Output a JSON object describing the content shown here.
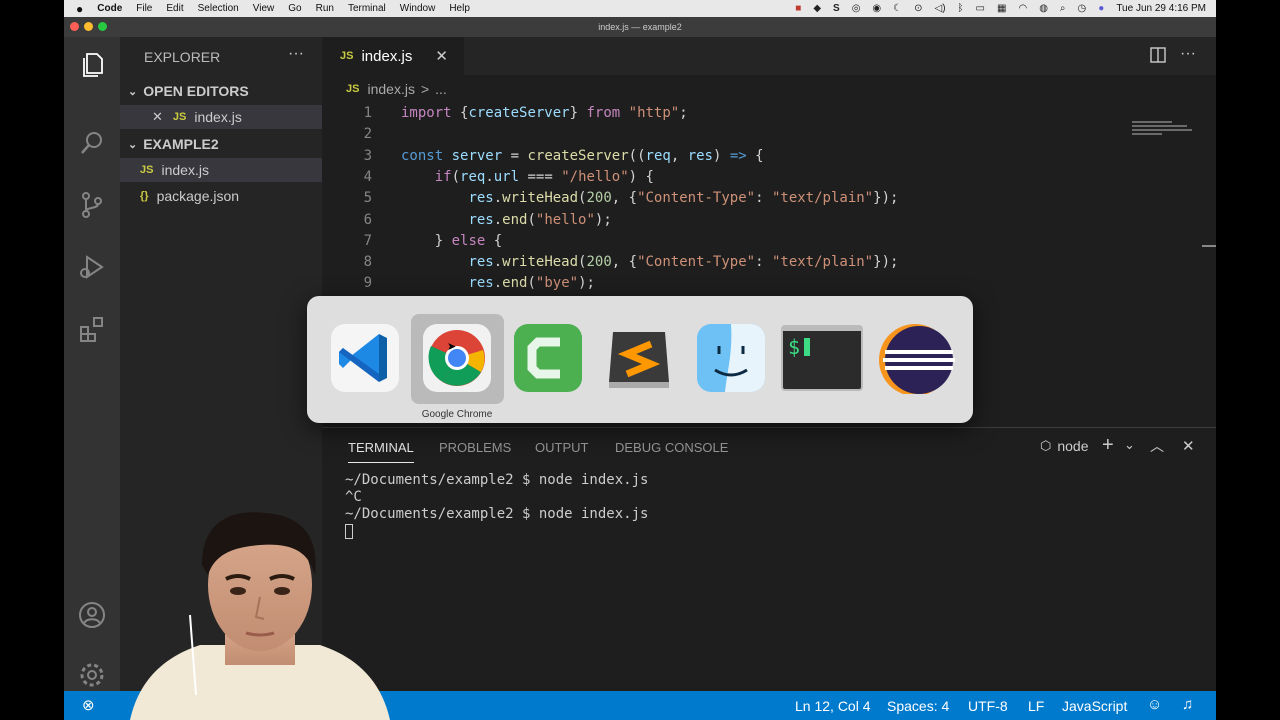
{
  "menubar": {
    "app_name": "Code",
    "items": [
      "File",
      "Edit",
      "Selection",
      "View",
      "Go",
      "Run",
      "Terminal",
      "Window",
      "Help"
    ],
    "clock": "Tue Jun 29  4:16 PM"
  },
  "window": {
    "title": "index.js — example2"
  },
  "explorer": {
    "title": "EXPLORER",
    "open_editors_label": "OPEN EDITORS",
    "open_editors": [
      {
        "badge": "JS",
        "name": "index.js"
      }
    ],
    "folder_label": "EXAMPLE2",
    "files": [
      {
        "badge": "JS",
        "name": "index.js"
      },
      {
        "badge": "{}",
        "name": "package.json"
      }
    ]
  },
  "editor": {
    "tab": {
      "badge": "JS",
      "name": "index.js"
    },
    "breadcrumb": {
      "badge": "JS",
      "file": "index.js",
      "sep": ">",
      "more": "..."
    },
    "lines": [
      {
        "n": "1",
        "text": "import {createServer} from \"http\";"
      },
      {
        "n": "2",
        "text": ""
      },
      {
        "n": "3",
        "text": "const server = createServer((req, res) => {"
      },
      {
        "n": "4",
        "text": "    if(req.url === \"/hello\") {"
      },
      {
        "n": "5",
        "text": "        res.writeHead(200, {\"Content-Type\": \"text/plain\"});"
      },
      {
        "n": "6",
        "text": "        res.end(\"hello\");"
      },
      {
        "n": "7",
        "text": "    } else {"
      },
      {
        "n": "8",
        "text": "        res.writeHead(200, {\"Content-Type\": \"text/plain\"});"
      },
      {
        "n": "9",
        "text": "        res.end(\"bye\");"
      }
    ]
  },
  "panel": {
    "tabs": [
      "TERMINAL",
      "PROBLEMS",
      "OUTPUT",
      "DEBUG CONSOLE"
    ],
    "active_tab": "TERMINAL",
    "shell": "node",
    "terminal_lines": [
      "~/Documents/example2 $ node index.js",
      "^C",
      "~/Documents/example2 $ node index.js"
    ]
  },
  "statusbar": {
    "position": "Ln 12, Col 4",
    "spaces": "Spaces: 4",
    "encoding": "UTF-8",
    "eol": "LF",
    "language": "JavaScript"
  },
  "app_switcher": {
    "apps": [
      "vscode-icon",
      "chrome-icon",
      "camtasia-icon",
      "sublime-text-icon",
      "finder-icon",
      "terminal-icon",
      "eclipse-icon"
    ],
    "selected_label": "Google Chrome"
  },
  "colors": {
    "statusbar": "#007acc",
    "activitybar": "#333333",
    "sidebar": "#252526",
    "editor": "#1e1e1e"
  }
}
